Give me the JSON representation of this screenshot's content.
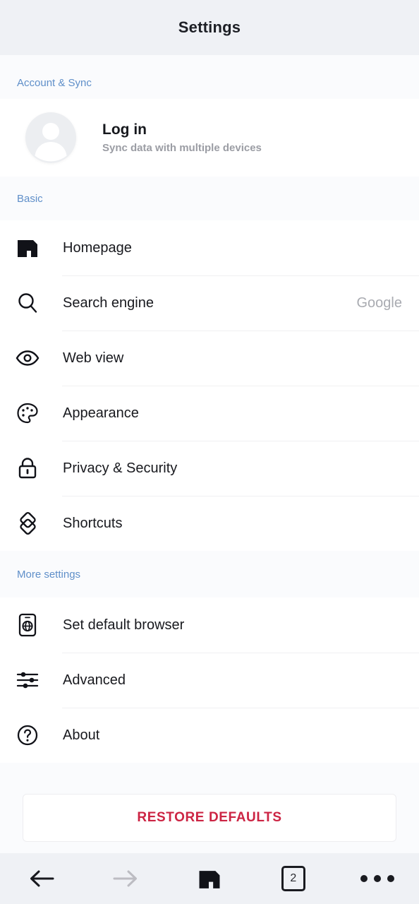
{
  "header": {
    "title": "Settings"
  },
  "sections": {
    "account": {
      "label": "Account & Sync"
    },
    "basic": {
      "label": "Basic"
    },
    "more": {
      "label": "More settings"
    }
  },
  "account": {
    "title": "Log in",
    "subtitle": "Sync data with multiple devices",
    "avatar_icon": "person-avatar-icon"
  },
  "basic_items": [
    {
      "label": "Homepage",
      "value": "",
      "icon": "maxthon-logo-icon"
    },
    {
      "label": "Search engine",
      "value": "Google",
      "icon": "search-icon"
    },
    {
      "label": "Web view",
      "value": "",
      "icon": "eye-icon"
    },
    {
      "label": "Appearance",
      "value": "",
      "icon": "palette-icon"
    },
    {
      "label": "Privacy & Security",
      "value": "",
      "icon": "lock-icon"
    },
    {
      "label": "Shortcuts",
      "value": "",
      "icon": "layers-diamond-icon"
    }
  ],
  "more_items": [
    {
      "label": "Set default browser",
      "value": "",
      "icon": "phone-globe-icon"
    },
    {
      "label": "Advanced",
      "value": "",
      "icon": "sliders-icon"
    },
    {
      "label": "About",
      "value": "",
      "icon": "question-circle-icon"
    }
  ],
  "restore": {
    "label": "RESTORE DEFAULTS"
  },
  "bottomnav": {
    "back_icon": "arrow-left-icon",
    "forward_icon": "arrow-right-icon",
    "home_icon": "maxthon-logo-icon",
    "tab_count": "2",
    "menu_icon": "more-dots-icon"
  },
  "colors": {
    "header_bg": "#eff1f5",
    "section_label": "#5f8fc9",
    "section_bg": "#fafbfd",
    "row_text": "#18191e",
    "row_value": "#a9abb1",
    "restore_text": "#cc2443",
    "divider": "#f0f0f2",
    "forward_disabled": "#bcbcc2"
  }
}
